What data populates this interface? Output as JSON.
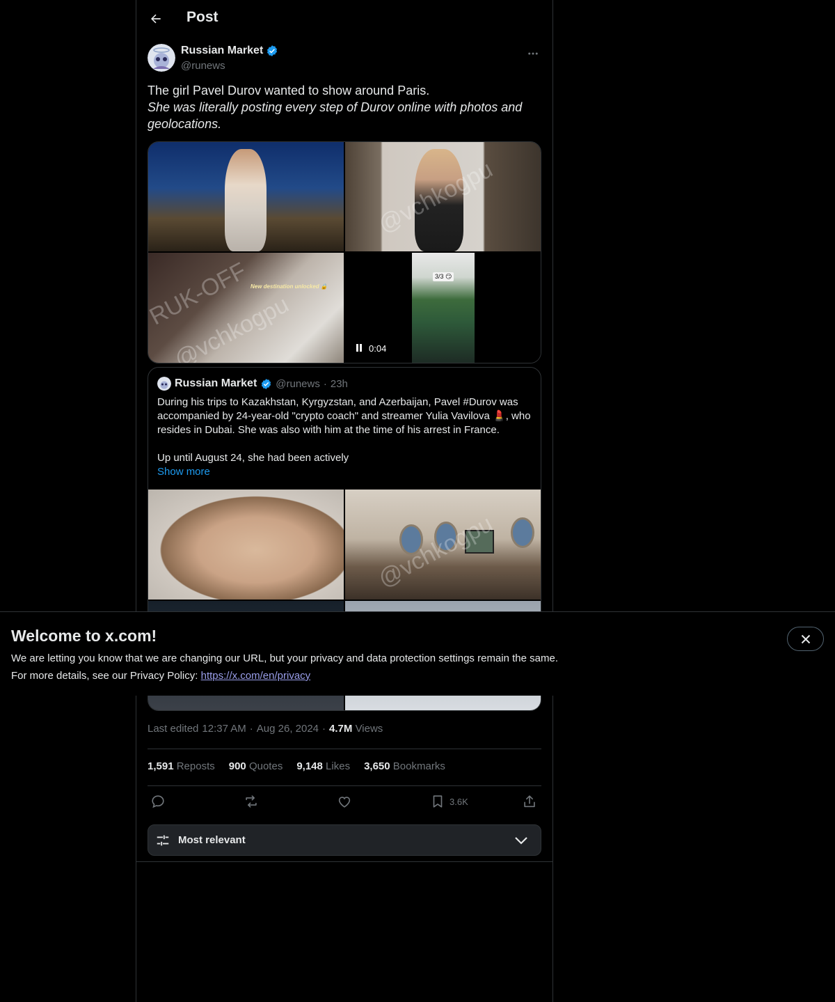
{
  "header": {
    "title": "Post"
  },
  "post": {
    "author_name": "Russian Market",
    "author_handle": "@runews",
    "text_line1": "The girl Pavel Durov wanted to show around Paris.",
    "text_line2": "She was literally posting every step of Durov online with photos and geolocations.",
    "media_overlay_text": "New destination unlocked 🔒",
    "story_label": "3/3 😏",
    "video_time": "0:04",
    "watermark_1": "RUK-OFF",
    "watermark_2": "@vchkogpu",
    "edited_label": "Last edited",
    "edited_time": "12:37 AM",
    "edited_date": "Aug 26, 2024",
    "views_count": "4.7M",
    "views_label": "Views"
  },
  "quote": {
    "author_name": "Russian Market",
    "author_handle": "@runews",
    "time": "23h",
    "text_p1": "During his trips to Kazakhstan, Kyrgyzstan, and Azerbaijan, Pavel #Durov was accompanied by 24-year-old \"crypto coach\" and streamer Yulia Vavilova 💄, who resides in Dubai. She was also with him at the time of his arrest in France.",
    "text_p2": "Up until August 24, she had been actively",
    "show_more": "Show more"
  },
  "stats": {
    "reposts_count": "1,591",
    "reposts_label": "Reposts",
    "quotes_count": "900",
    "quotes_label": "Quotes",
    "likes_count": "9,148",
    "likes_label": "Likes",
    "bookmarks_count": "3,650",
    "bookmarks_label": "Bookmarks"
  },
  "actions": {
    "bookmark_count": "3.6K"
  },
  "sort": {
    "label": "Most relevant"
  },
  "banner": {
    "title": "Welcome to x.com!",
    "line1": "We are letting you know that we are changing our URL, but your privacy and data protection settings remain the same.",
    "line2_prefix": "For more details, see our Privacy Policy:",
    "link": "https://x.com/en/privacy"
  },
  "colors": {
    "accent": "#1d9bf0",
    "background": "#000000",
    "muted": "#71767b",
    "border": "#2f3336"
  },
  "icons": [
    "back-arrow-icon",
    "verified-badge-icon",
    "more-icon",
    "pause-icon",
    "reply-icon",
    "repost-icon",
    "like-icon",
    "bookmark-icon",
    "share-icon",
    "sliders-icon",
    "chevron-down-icon",
    "close-icon"
  ]
}
